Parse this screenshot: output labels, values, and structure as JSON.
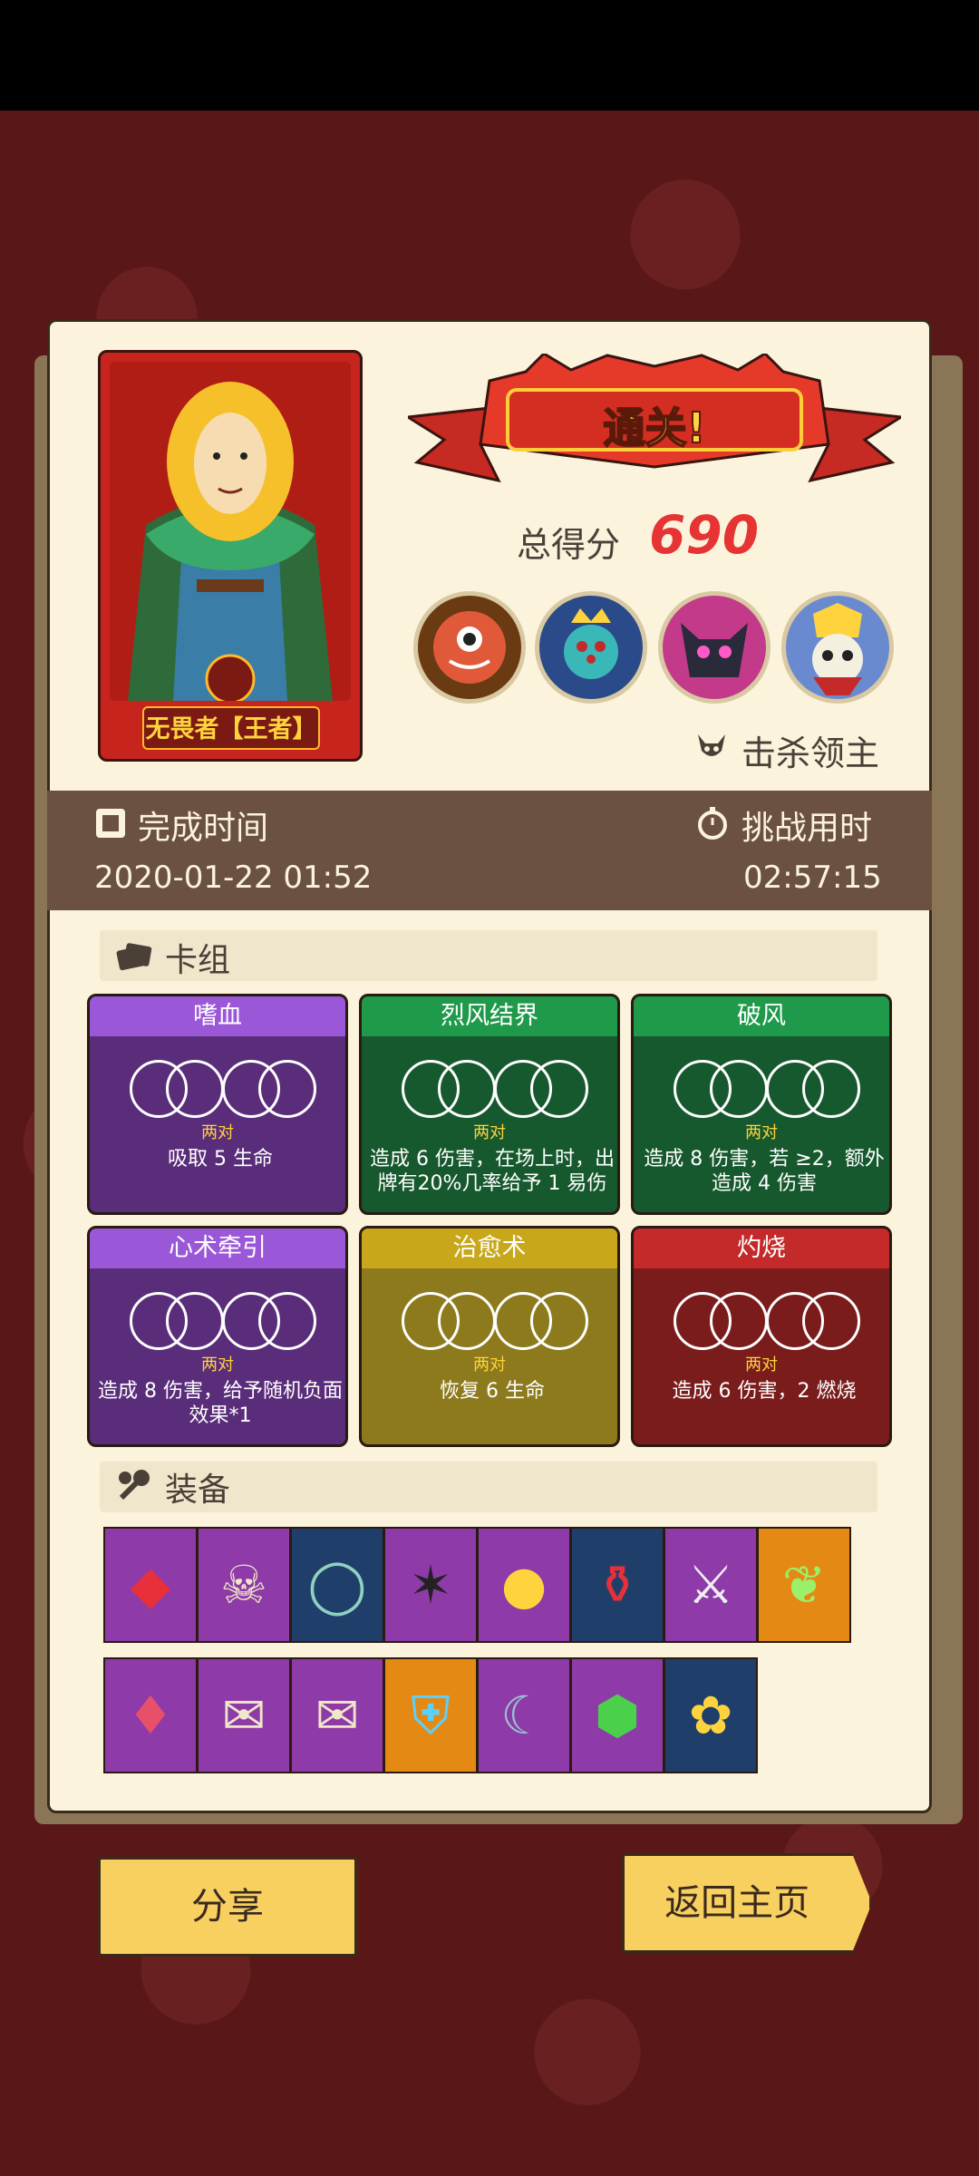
{
  "hero": {
    "name": "无畏者【王者】"
  },
  "result": {
    "banner": "通关!",
    "score_label": "总得分",
    "score_value": "690",
    "kill_label": "击杀领主",
    "bosses": [
      "boss-eye",
      "boss-crowned-spider",
      "boss-pink-demon",
      "boss-skull-king"
    ]
  },
  "times": {
    "complete_label": "完成时间",
    "complete_value": "2020-01-22 01:52",
    "challenge_label": "挑战用时",
    "challenge_value": "02:57:15"
  },
  "deck": {
    "label": "卡组",
    "cards": [
      {
        "title": "嗜血",
        "pair": "两对",
        "desc": "吸取 5 生命",
        "color": "#5a2d7a",
        "bar": "#9a57d8"
      },
      {
        "title": "烈风结界",
        "pair": "两对",
        "desc": "造成 6 伤害，在场上时，出牌有20%几率给予 1 易伤",
        "color": "#17592e",
        "bar": "#1f9a4a"
      },
      {
        "title": "破风",
        "pair": "两对",
        "desc": "造成 8 伤害，若 ≥2，额外造成 4 伤害",
        "color": "#17592e",
        "bar": "#1f9a4a"
      },
      {
        "title": "心术牵引",
        "pair": "两对",
        "desc": "造成 8 伤害，给予随机负面效果*1",
        "color": "#5a2d7a",
        "bar": "#9a57d8"
      },
      {
        "title": "治愈术",
        "pair": "两对",
        "desc": "恢复 6 生命",
        "color": "#8c7a1c",
        "bar": "#c8a81a"
      },
      {
        "title": "灼烧",
        "pair": "两对",
        "desc": "造成 6 伤害，2 燃烧",
        "color": "#7a1c1c",
        "bar": "#c42a2a"
      }
    ]
  },
  "equipment": {
    "label": "装备",
    "row1": [
      "ruby-icon",
      "skull-book-icon",
      "ring-icon",
      "cracked-crest-icon",
      "gold-orb-icon",
      "potion-jar-icon",
      "dagger-icon",
      "green-feather-icon"
    ],
    "row2": [
      "pendant-icon",
      "fire-scroll-icon",
      "skull-scroll-icon",
      "skull-shield-icon",
      "scythe-icon",
      "emerald-icon",
      "gold-clover-icon"
    ],
    "row1_bg": [
      "#8e3aa8",
      "#8e3aa8",
      "#1f3f6a",
      "#8e3aa8",
      "#8e3aa8",
      "#1f3f6a",
      "#8e3aa8",
      "#e48a14"
    ],
    "row2_bg": [
      "#8e3aa8",
      "#8e3aa8",
      "#8e3aa8",
      "#e48a14",
      "#8e3aa8",
      "#8e3aa8",
      "#1f3f6a"
    ]
  },
  "buttons": {
    "share": "分享",
    "home": "返回主页"
  }
}
